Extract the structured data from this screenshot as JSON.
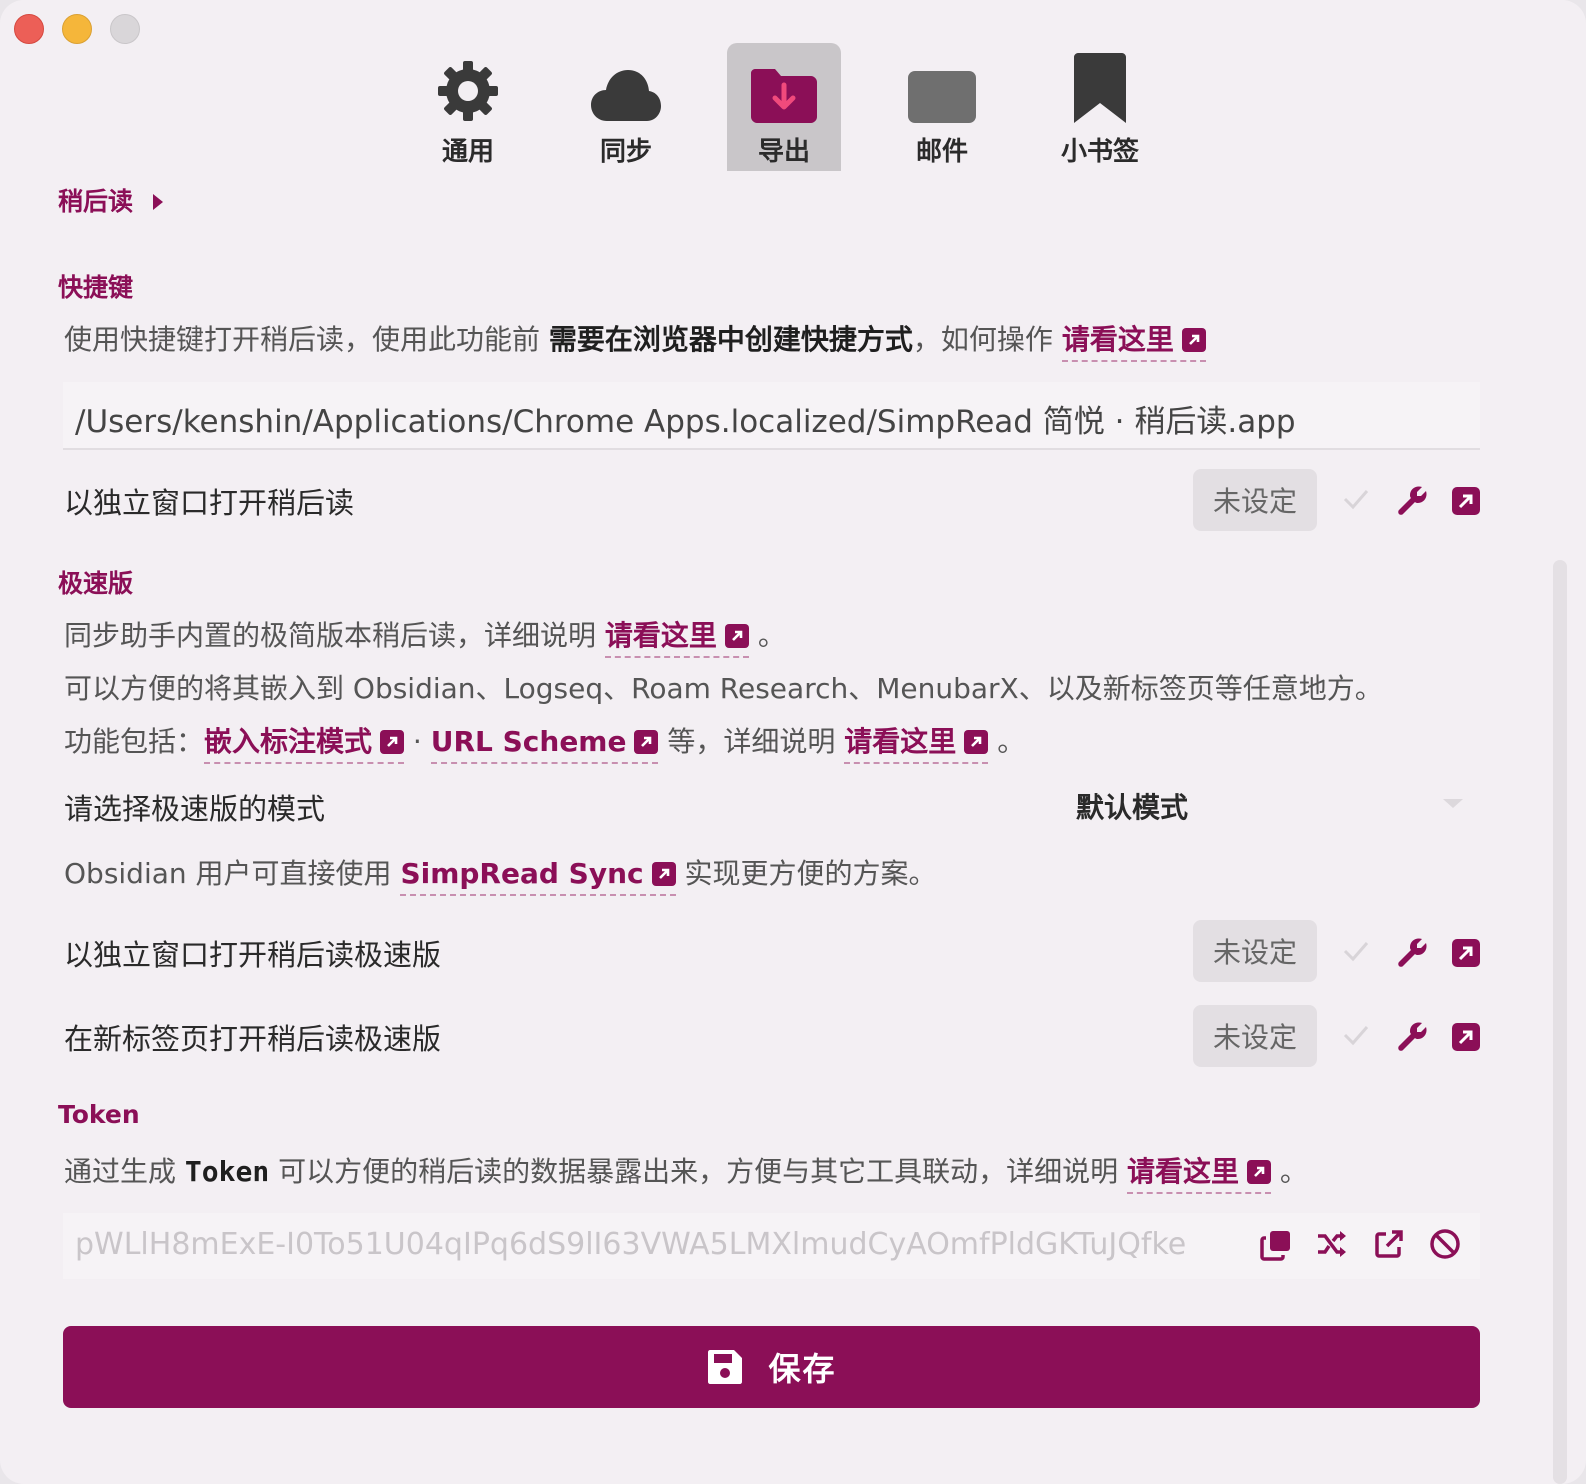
{
  "tabs": [
    {
      "label": "通用",
      "icon": "gear-icon"
    },
    {
      "label": "同步",
      "icon": "cloud-icon"
    },
    {
      "label": "导出",
      "icon": "folder-download-icon",
      "active": true
    },
    {
      "label": "邮件",
      "icon": "mail-icon"
    },
    {
      "label": "小书签",
      "icon": "bookmark-icon"
    }
  ],
  "breadcrumb": "稍后读",
  "shortcut": {
    "title": "快捷键",
    "desc_prefix": "使用快捷键打开稍后读，使用此功能前 ",
    "desc_strong": "需要在浏览器中创建快捷方式",
    "desc_mid": "，如何操作 ",
    "link": "请看这里",
    "path_value": "/Users/kenshin/Applications/Chrome Apps.localized/SimpRead 简悦 · 稍后读.app",
    "row_label": "以独立窗口打开稍后读",
    "unset": "未设定"
  },
  "lite": {
    "title": "极速版",
    "line1_prefix": "同步助手内置的极简版本稍后读，详细说明 ",
    "line1_link": "请看这里",
    "line1_suffix": " 。",
    "line2": "可以方便的将其嵌入到 Obsidian、Logseq、Roam Research、MenubarX、以及新标签页等任意地方。",
    "line3_prefix": "功能包括：",
    "line3_link1": "嵌入标注模式",
    "line3_sep": " · ",
    "line3_link2": "URL Scheme",
    "line3_mid": " 等，详细说明 ",
    "line3_link3": "请看这里",
    "line3_suffix": " 。",
    "mode_label": "请选择极速版的模式",
    "mode_value": "默认模式",
    "obsidian_prefix": "Obsidian 用户可直接使用 ",
    "obsidian_link": "SimpRead Sync",
    "obsidian_suffix": " 实现更方便的方案。",
    "row1_label": "以独立窗口打开稍后读极速版",
    "row2_label": "在新标签页打开稍后读极速版",
    "unset": "未设定"
  },
  "token": {
    "title": "Token",
    "desc_prefix": "通过生成 ",
    "desc_code": "Token",
    "desc_mid": " 可以方便的稍后读的数据暴露出来，方便与其它工具联动，详细说明 ",
    "desc_link": "请看这里",
    "desc_suffix": " 。",
    "value": "pWLlH8mExE-I0To51U04qIPq6dS9lI63VWA5LMXlmudCyAOmfPldGKTuJQfke"
  },
  "save_label": "保存",
  "colors": {
    "accent": "#8b0f57",
    "window_bg": "#f3eff3"
  }
}
